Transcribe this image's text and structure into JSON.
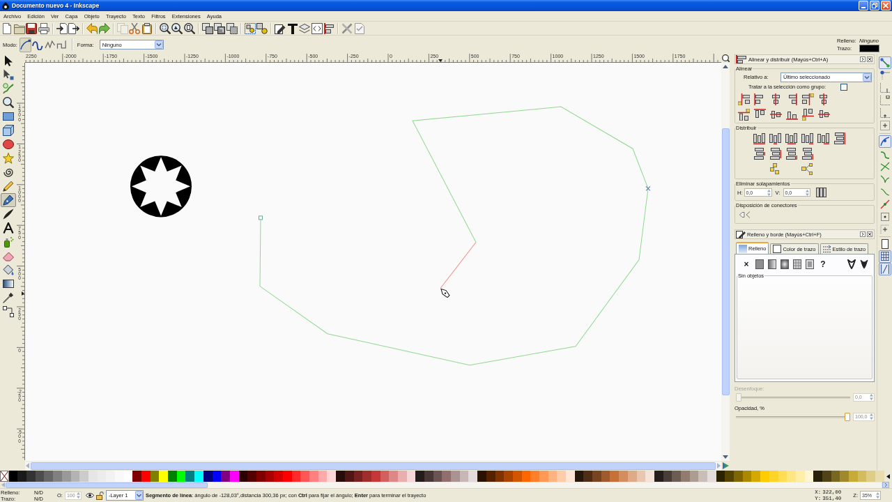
{
  "window": {
    "title": "Documento nuevo 4 - Inkscape",
    "controls": [
      {
        "kind": "minimize"
      },
      {
        "kind": "restore"
      },
      {
        "kind": "close"
      }
    ]
  },
  "menu": [
    "Archivo",
    "Edición",
    "Ver",
    "Capa",
    "Objeto",
    "Trayecto",
    "Texto",
    "Filtros",
    "Extensiones",
    "Ayuda"
  ],
  "commands": [
    [
      {
        "kind": "new",
        "disabled": false
      },
      {
        "kind": "open",
        "disabled": false
      },
      {
        "kind": "save",
        "disabled": false
      },
      {
        "kind": "print",
        "disabled": false
      }
    ],
    [
      {
        "kind": "import",
        "disabled": false
      },
      {
        "kind": "export",
        "disabled": false
      }
    ],
    [
      {
        "kind": "undo",
        "disabled": false
      },
      {
        "kind": "redo",
        "disabled": false
      }
    ],
    [
      {
        "kind": "copy",
        "disabled": true
      },
      {
        "kind": "cut",
        "disabled": false
      },
      {
        "kind": "paste",
        "disabled": false
      }
    ],
    [
      {
        "kind": "zoom-selection",
        "disabled": false
      },
      {
        "kind": "zoom-drawing",
        "disabled": false
      },
      {
        "kind": "zoom-page",
        "disabled": false
      }
    ],
    [
      {
        "kind": "duplicate",
        "disabled": false
      },
      {
        "kind": "clone",
        "disabled": false
      },
      {
        "kind": "unlink",
        "disabled": false
      }
    ],
    [
      {
        "kind": "group",
        "disabled": false
      },
      {
        "kind": "ungroup",
        "disabled": false
      }
    ],
    [
      {
        "kind": "fill-stroke",
        "disabled": false
      },
      {
        "kind": "text",
        "disabled": false
      },
      {
        "kind": "layers",
        "disabled": false
      },
      {
        "kind": "xml",
        "disabled": false
      },
      {
        "kind": "align",
        "disabled": false
      }
    ],
    [
      {
        "kind": "preferences",
        "disabled": false
      },
      {
        "kind": "document",
        "disabled": false
      }
    ]
  ],
  "tool_controls": {
    "mode_label": "Modo:",
    "modes": [
      {
        "kind": "bezier",
        "selected": true
      },
      {
        "kind": "spiro",
        "selected": false
      },
      {
        "kind": "zigzag",
        "selected": false
      },
      {
        "kind": "paraxial",
        "selected": false
      }
    ],
    "shape_label": "Forma:",
    "shape_value": "Ninguno",
    "style": [
      {
        "label": "Relleno:",
        "value": "Ninguno"
      },
      {
        "label": "Trazo:",
        "color": "#000000"
      }
    ]
  },
  "toolbox": [
    {
      "kind": "selector",
      "selected": false
    },
    {
      "kind": "node",
      "selected": false
    },
    {
      "kind": "tweak",
      "selected": false
    },
    {
      "kind": "zoom",
      "selected": false
    },
    {
      "kind": "rect",
      "selected": false
    },
    {
      "kind": "box3d",
      "selected": false
    },
    {
      "kind": "ellipse",
      "selected": false
    },
    {
      "kind": "star",
      "selected": false
    },
    {
      "kind": "spiral",
      "selected": false
    },
    {
      "kind": "pencil",
      "selected": false
    },
    {
      "kind": "pen",
      "selected": true
    },
    {
      "kind": "calligraphy",
      "selected": false
    },
    {
      "kind": "text",
      "selected": false
    },
    {
      "kind": "spray",
      "selected": false
    },
    {
      "kind": "eraser",
      "selected": false
    },
    {
      "kind": "bucket",
      "selected": false
    },
    {
      "kind": "gradient",
      "selected": false
    },
    {
      "kind": "dropper",
      "selected": false
    },
    {
      "kind": "connector",
      "selected": false
    }
  ],
  "horizontal_ruler": {
    "labels": [
      "2250",
      "-2000",
      "-1750",
      "-1500",
      "-1250",
      "-1000",
      "-750",
      "-500",
      "-250",
      "0",
      "250",
      "500",
      "750",
      "1000",
      "1250",
      "1500",
      "1750"
    ]
  },
  "vertical_ruler": {
    "labels": [
      "1500",
      "1250",
      "1000",
      "750",
      "500",
      "250",
      "0",
      "-250",
      "-500"
    ]
  },
  "dock": {
    "align": {
      "title": "Alinear y distribuir (Mayús+Ctrl+A)",
      "align_label": "Alinear",
      "relative_label": "Relativo a:",
      "relative_value": "Último seleccionado",
      "group_checkbox": {
        "label": "Tratar a la selección como grupo:",
        "checked": false
      },
      "distribute_label": "Distribuir",
      "overlap_label": "Eliminar solapamientos",
      "h_label": "H:",
      "h_value": "0,0",
      "v_label": "V:",
      "v_value": "0,0",
      "connectors_label": "Disposición de conectores"
    },
    "fill_stroke": {
      "title": "Relleno y borde (Mayús+Ctrl+F)",
      "tabs": [
        {
          "kind": "fill",
          "label": "Relleno",
          "selected": true
        },
        {
          "kind": "stroke-paint",
          "label": "Color de trazo",
          "selected": false
        },
        {
          "kind": "stroke-style",
          "label": "Estilo de trazo",
          "selected": false
        }
      ],
      "paint_modes": [
        {
          "kind": "none",
          "label": "×"
        },
        {
          "kind": "flat"
        },
        {
          "kind": "linear"
        },
        {
          "kind": "radial"
        },
        {
          "kind": "pattern"
        },
        {
          "kind": "swatch"
        },
        {
          "kind": "unset",
          "label": "?"
        },
        {
          "kind": "evenodd"
        },
        {
          "kind": "nonzero"
        }
      ],
      "frame_label": "Sin objetos",
      "blur": {
        "label": "Desenfoque:",
        "value": "0,0",
        "level": 0,
        "disabled": true
      },
      "opacity": {
        "label": "Opacidad, %",
        "value": "100,0",
        "level": 1,
        "disabled": false
      }
    }
  },
  "snap_bar": [
    [
      {
        "kind": "snap-toggle",
        "on": true
      },
      {
        "kind": "bbox",
        "on": false
      },
      {
        "kind": "bbox-edge",
        "on": false
      },
      {
        "kind": "bbox-corner",
        "on": false
      },
      {
        "kind": "bbox-midpoint",
        "on": false
      },
      {
        "kind": "bbox-center",
        "on": false
      }
    ],
    [
      {
        "kind": "nodes",
        "on": true
      },
      {
        "kind": "path",
        "on": false
      },
      {
        "kind": "intersection",
        "on": false
      },
      {
        "kind": "cusp",
        "on": false
      },
      {
        "kind": "smooth",
        "on": false
      },
      {
        "kind": "midpoint",
        "on": false
      },
      {
        "kind": "object-center",
        "on": false
      },
      {
        "kind": "rotation-center",
        "on": false
      }
    ],
    [
      {
        "kind": "page",
        "on": false
      },
      {
        "kind": "grid",
        "on": true
      },
      {
        "kind": "guide",
        "on": true
      }
    ]
  ],
  "palette": [
    {
      "color": "#000000"
    },
    {
      "color": "#1a1a1a"
    },
    {
      "color": "#333333"
    },
    {
      "color": "#4d4d4d"
    },
    {
      "color": "#666666"
    },
    {
      "color": "#808080"
    },
    {
      "color": "#999999"
    },
    {
      "color": "#b3b3b3"
    },
    {
      "color": "#cccccc"
    },
    {
      "color": "#e6e6e6"
    },
    {
      "color": "#ececec"
    },
    {
      "color": "#f2f2f2"
    },
    {
      "color": "#f9f9f9"
    },
    {
      "color": "#ffffff"
    },
    {
      "color": "#800000"
    },
    {
      "color": "#ff0000"
    },
    {
      "color": "#808000"
    },
    {
      "color": "#ffff00"
    },
    {
      "color": "#008000"
    },
    {
      "color": "#00ff00"
    },
    {
      "color": "#008080"
    },
    {
      "color": "#00ffff"
    },
    {
      "color": "#000080"
    },
    {
      "color": "#0000ff"
    },
    {
      "color": "#800080"
    },
    {
      "color": "#ff00ff"
    },
    {
      "color": "#2b0000"
    },
    {
      "color": "#550000"
    },
    {
      "color": "#800000"
    },
    {
      "color": "#aa0000"
    },
    {
      "color": "#d40000"
    },
    {
      "color": "#ff0000"
    },
    {
      "color": "#ff2a2a"
    },
    {
      "color": "#ff5555"
    },
    {
      "color": "#ff8080"
    },
    {
      "color": "#ffaaaa"
    },
    {
      "color": "#ffd5d5"
    },
    {
      "color": "#280b0b"
    },
    {
      "color": "#501616"
    },
    {
      "color": "#782121"
    },
    {
      "color": "#a02c2c"
    },
    {
      "color": "#c83737"
    },
    {
      "color": "#d35f5f"
    },
    {
      "color": "#de8787"
    },
    {
      "color": "#e9afaf"
    },
    {
      "color": "#f4d7d7"
    },
    {
      "color": "#241c1c"
    },
    {
      "color": "#483737"
    },
    {
      "color": "#6c5353"
    },
    {
      "color": "#916f6f"
    },
    {
      "color": "#ac9393"
    },
    {
      "color": "#c8b7b7"
    },
    {
      "color": "#e3dbdb"
    },
    {
      "color": "#2b1100"
    },
    {
      "color": "#552200"
    },
    {
      "color": "#803300"
    },
    {
      "color": "#aa4400"
    },
    {
      "color": "#d45500"
    },
    {
      "color": "#ff6600"
    },
    {
      "color": "#ff7f2a"
    },
    {
      "color": "#ff9955"
    },
    {
      "color": "#ffb380"
    },
    {
      "color": "#ffccaa"
    },
    {
      "color": "#ffe6d5"
    },
    {
      "color": "#28170b"
    },
    {
      "color": "#502d16"
    },
    {
      "color": "#784421"
    },
    {
      "color": "#a05a2c"
    },
    {
      "color": "#c87137"
    },
    {
      "color": "#d38d5f"
    },
    {
      "color": "#deaa87"
    },
    {
      "color": "#e9c6af"
    },
    {
      "color": "#f4e3d7"
    },
    {
      "color": "#241f1c"
    },
    {
      "color": "#483e37"
    },
    {
      "color": "#6c5d53"
    },
    {
      "color": "#917c6f"
    },
    {
      "color": "#ac9d93"
    },
    {
      "color": "#c8beb7"
    },
    {
      "color": "#e3dedb"
    },
    {
      "color": "#2b2200"
    },
    {
      "color": "#554400"
    },
    {
      "color": "#806600"
    },
    {
      "color": "#aa8800"
    },
    {
      "color": "#d4aa00"
    },
    {
      "color": "#ffcc00"
    },
    {
      "color": "#ffd42a"
    },
    {
      "color": "#ffdd55"
    },
    {
      "color": "#ffe680"
    },
    {
      "color": "#ffeeaa"
    },
    {
      "color": "#fff6d5"
    },
    {
      "color": "#28220b"
    },
    {
      "color": "#504416"
    },
    {
      "color": "#786721"
    },
    {
      "color": "#a0892c"
    },
    {
      "color": "#c8ab37"
    },
    {
      "color": "#d3bc5f"
    },
    {
      "color": "#decd87"
    },
    {
      "color": "#e9ddaf"
    }
  ],
  "status_bar": {
    "fill_label": "Relleno:",
    "fill_value": "N/D",
    "stroke_label": "Trazo:",
    "stroke_value": "N/D",
    "opacity_label": "O:",
    "opacity_value": "100",
    "opacity_disabled": true,
    "layer_visible": true,
    "layer_locked": false,
    "layer": "-Layer 1",
    "message": "**Segmento de línea**: ángulo de -128,03°,distancia 300,36 px; con **Ctrl** para fijar el ángulo; **Enter** para terminar el trayecto",
    "x_label": "X:",
    "x_value": "322,00",
    "y_label": "Y:",
    "y_value": "351,40",
    "zoom_label": "Z:",
    "zoom_value": "35%"
  }
}
